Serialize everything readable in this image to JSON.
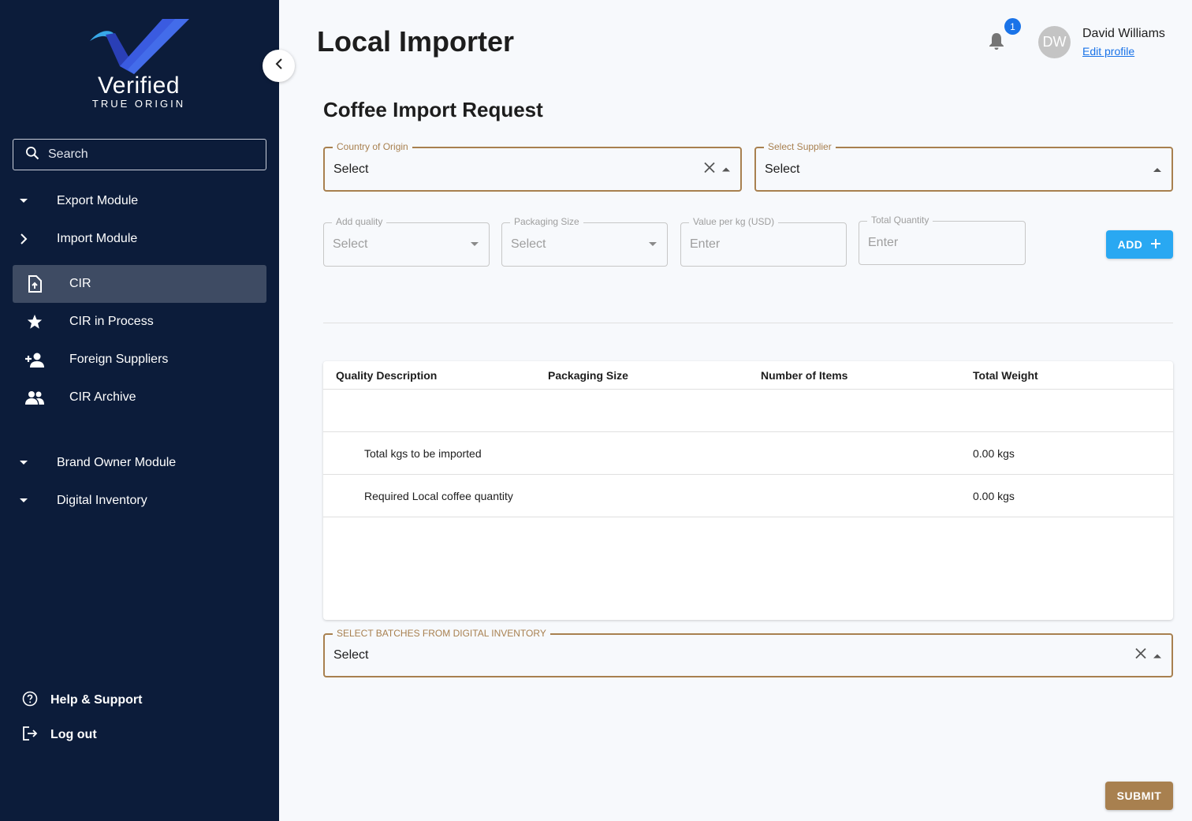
{
  "brand": {
    "name": "Verified",
    "tagline": "TRUE ORIGIN"
  },
  "search": {
    "placeholder": "Search"
  },
  "sidebar": {
    "modules": [
      {
        "label": "Export Module",
        "expanded": false
      },
      {
        "label": "Import Module",
        "expanded": true
      },
      {
        "label": "Brand Owner Module",
        "expanded": false
      },
      {
        "label": "Digital Inventory",
        "expanded": false
      }
    ],
    "import_items": [
      {
        "label": "CIR",
        "icon": "file-upload-icon",
        "active": true
      },
      {
        "label": "CIR in Process",
        "icon": "star-icon",
        "active": false
      },
      {
        "label": "Foreign Suppliers",
        "icon": "person-add-icon",
        "active": false
      },
      {
        "label": "CIR Archive",
        "icon": "people-icon",
        "active": false
      }
    ],
    "footer": {
      "help": "Help & Support",
      "logout": "Log out"
    }
  },
  "header": {
    "title": "Local Importer",
    "notification_count": "1",
    "user": {
      "initials": "DW",
      "name": "David Williams",
      "edit_label": "Edit profile"
    }
  },
  "form": {
    "title": "Coffee Import Request",
    "country": {
      "label": "Country of Origin",
      "value": "Select"
    },
    "supplier": {
      "label": "Select Supplier",
      "value": "Select"
    },
    "quality": {
      "label": "Add quality",
      "value": "Select"
    },
    "packaging": {
      "label": "Packaging Size",
      "value": "Select"
    },
    "value_per_kg": {
      "label": "Value per kg (USD)",
      "placeholder": "Enter"
    },
    "total_quantity": {
      "label": "Total Quantity",
      "placeholder": "Enter"
    },
    "add_label": "ADD",
    "batches": {
      "label": "SELECT BATCHES FROM DIGITAL INVENTORY",
      "value": "Select"
    },
    "submit_label": "SUBMIT"
  },
  "table": {
    "headers": [
      "Quality Description",
      "Packaging Size",
      "Number of Items",
      "Total Weight"
    ],
    "summary": [
      {
        "label": "Total kgs  to be imported",
        "value": "0.00 kgs"
      },
      {
        "label": "Required Local coffee  quantity",
        "value": "0.00 kgs"
      }
    ]
  },
  "colors": {
    "sidebar": "#0c1c3a",
    "accent_gold": "#a8804f",
    "add_button": "#29a8f2",
    "link": "#1a73e8"
  }
}
